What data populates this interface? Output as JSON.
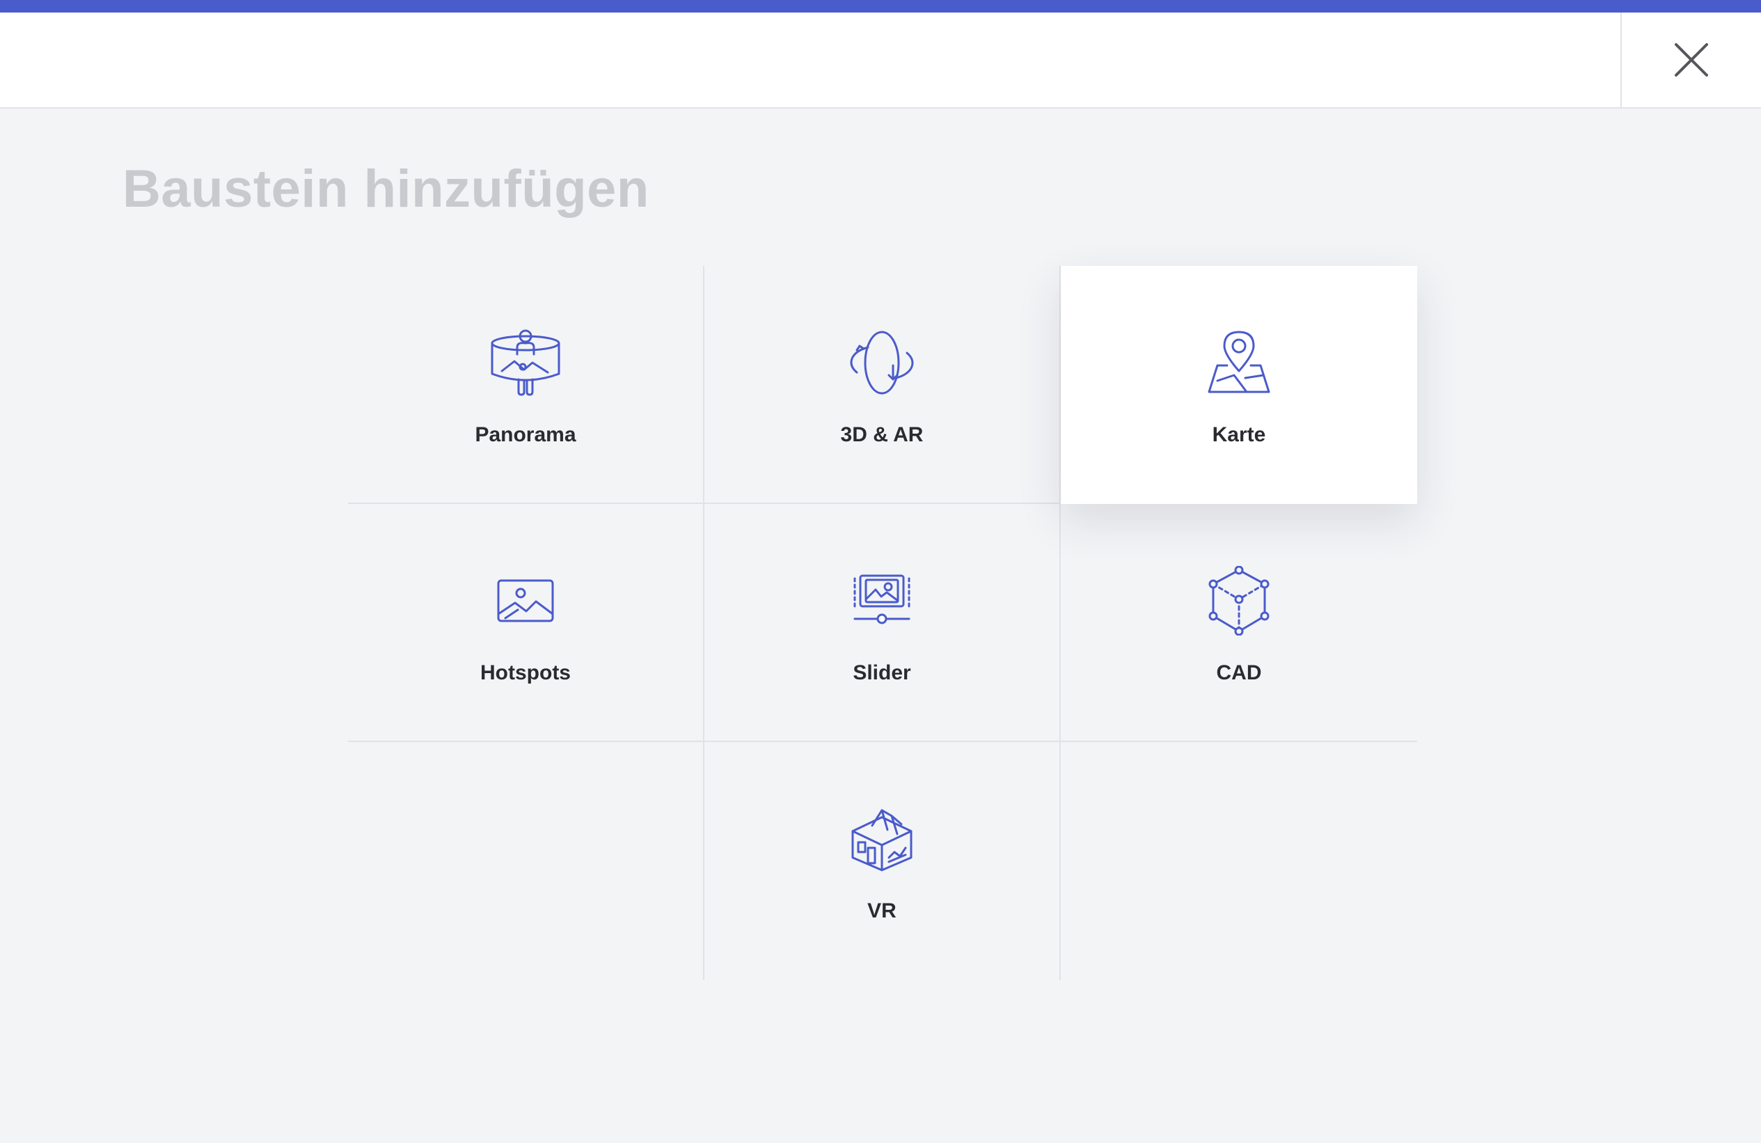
{
  "header": {
    "close_icon": "close-icon"
  },
  "title": "Baustein hinzufügen",
  "colors": {
    "accent": "#4a5bcb",
    "icon": "#4a5bcb",
    "background": "#f3f4f6",
    "title": "#c9cace"
  },
  "blocks": [
    {
      "label": "Panorama",
      "icon": "panorama-icon"
    },
    {
      "label": "3D & AR",
      "icon": "3d-ar-icon"
    },
    {
      "label": "Karte",
      "icon": "map-pin-icon",
      "state": "hovered"
    },
    {
      "label": "Hotspots",
      "icon": "image-icon"
    },
    {
      "label": "Slider",
      "icon": "slider-icon"
    },
    {
      "label": "CAD",
      "icon": "cube-icon"
    },
    {
      "label": "VR",
      "icon": "house-icon"
    }
  ]
}
